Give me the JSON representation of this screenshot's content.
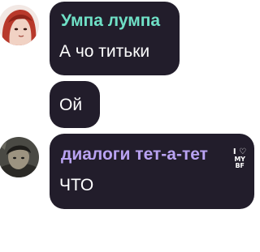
{
  "messages": [
    {
      "sender": "Умпа лумпа",
      "sender_color": "#6fe0c6",
      "text": "А чо титьки",
      "avatar": "redhead-avatar"
    },
    {
      "text": "Ой"
    },
    {
      "sender": "диалоги тет-а-тет",
      "sender_color": "#b9a3f2",
      "text": "ЧТО",
      "avatar": "dark-character-avatar",
      "badge": {
        "top": "I ♡",
        "bottom": "MY BF"
      }
    }
  ],
  "colors": {
    "bubble": "#221d2b",
    "text": "#ffffff"
  }
}
